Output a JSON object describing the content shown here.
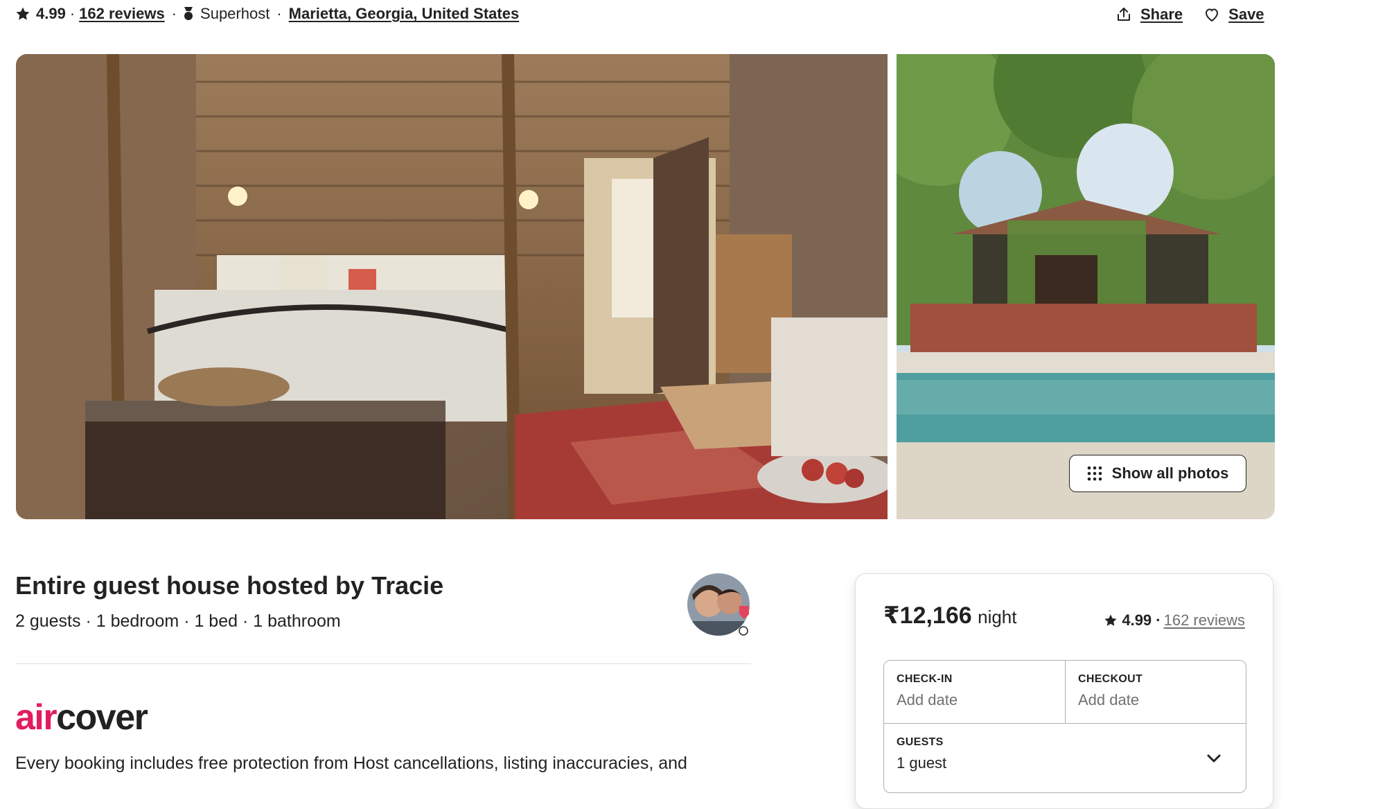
{
  "header": {
    "rating": "4.99",
    "dot": "·",
    "reviews_link": "162 reviews",
    "superhost_label": "Superhost",
    "location_link": "Marietta, Georgia, United States",
    "share_label": "Share",
    "save_label": "Save"
  },
  "gallery": {
    "show_all_label": "Show all photos"
  },
  "listing": {
    "title": "Entire guest house hosted by Tracie",
    "specs": "2 guests · 1 bedroom · 1 bed · 1 bathroom"
  },
  "aircover": {
    "logo_air": "air",
    "logo_cover": "cover",
    "description": "Every booking includes free protection from Host cancellations, listing inaccuracies, and"
  },
  "booking": {
    "price": "₹12,166",
    "per": "night",
    "rating": "4.99 ·",
    "reviews_link": "162 reviews",
    "checkin_label": "CHECK-IN",
    "checkin_value": "Add date",
    "checkout_label": "CHECKOUT",
    "checkout_value": "Add date",
    "guests_label": "GUESTS",
    "guests_value": "1 guest"
  },
  "colors": {
    "text": "#222222",
    "muted": "#717171",
    "brand": "#E31C5F",
    "border": "#DDDDDD"
  },
  "icons": [
    "star-icon",
    "superhost-medal-icon",
    "share-icon",
    "heart-icon",
    "grid-dots-icon",
    "chevron-down-icon"
  ]
}
